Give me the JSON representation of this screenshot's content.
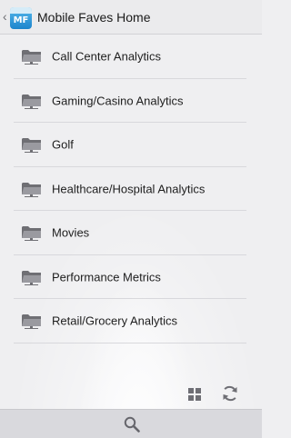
{
  "header": {
    "title": "Mobile Faves Home",
    "app_icon_text": "MF",
    "back_icon": "chevron-left-icon"
  },
  "list": {
    "items": [
      {
        "label": "Call Center Analytics",
        "icon": "folder-icon"
      },
      {
        "label": "Gaming/Casino Analytics",
        "icon": "folder-icon"
      },
      {
        "label": "Golf",
        "icon": "folder-icon"
      },
      {
        "label": "Healthcare/Hospital Analytics",
        "icon": "folder-icon"
      },
      {
        "label": "Movies",
        "icon": "folder-icon"
      },
      {
        "label": "Performance Metrics",
        "icon": "folder-icon"
      },
      {
        "label": "Retail/Grocery Analytics",
        "icon": "folder-icon"
      }
    ]
  },
  "toolbar": {
    "grid_icon": "grid-view-icon",
    "refresh_icon": "refresh-icon"
  },
  "footer": {
    "search_icon": "search-icon"
  },
  "colors": {
    "background": "#efeff1",
    "header": "#ebebed",
    "footer": "#d9d9dd",
    "folder": "#8a8a8f",
    "app_icon": "#2a8fd6"
  }
}
